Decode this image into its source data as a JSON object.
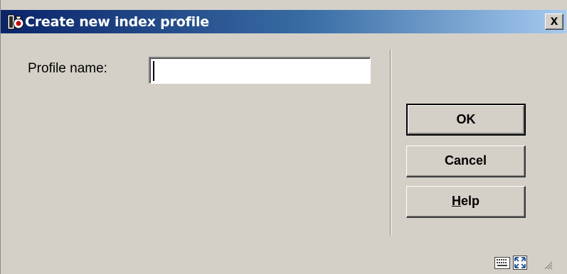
{
  "window": {
    "title": "Create new index profile",
    "close_glyph": "x",
    "icon": "library-app-icon"
  },
  "form": {
    "profile_name_label": "Profile name:",
    "profile_name_value": ""
  },
  "buttons": {
    "ok_label": "OK",
    "cancel_label": "Cancel",
    "help_label_mnemonic": "H",
    "help_label_rest": "elp"
  },
  "statusbar": {
    "icons": [
      "keyboard-icon",
      "resize-window-icon",
      "size-grip-icon"
    ]
  },
  "colors": {
    "titlebar_start": "#0a246a",
    "titlebar_end": "#a6caf0",
    "dialog_bg": "#d4d0c8"
  }
}
